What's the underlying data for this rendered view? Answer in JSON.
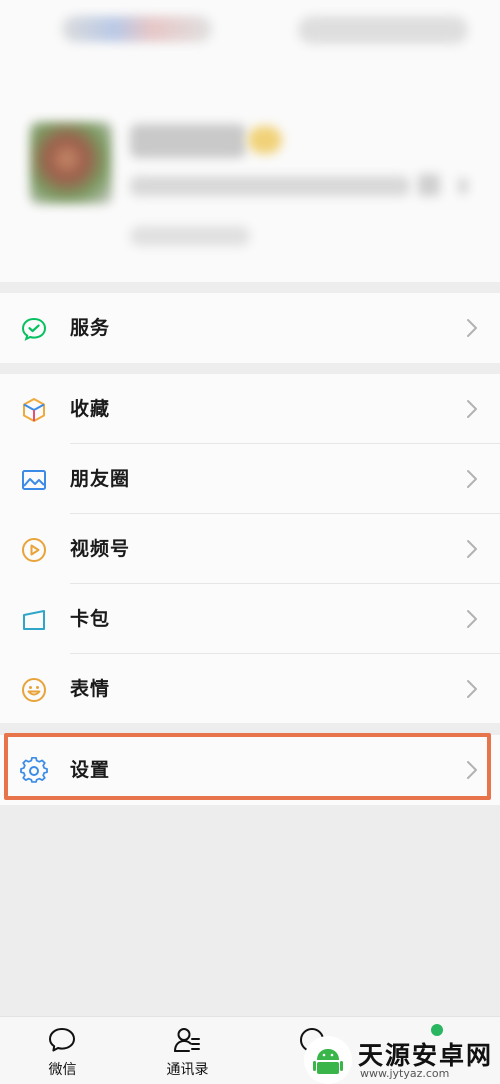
{
  "menu": {
    "service": {
      "label": "服务",
      "icon": "wechat-pay-icon"
    },
    "favorites": {
      "label": "收藏",
      "icon": "cube-icon"
    },
    "moments": {
      "label": "朋友圈",
      "icon": "photo-icon"
    },
    "channels": {
      "label": "视频号",
      "icon": "play-icon"
    },
    "cards": {
      "label": "卡包",
      "icon": "card-icon"
    },
    "stickers": {
      "label": "表情",
      "icon": "smiley-icon"
    },
    "settings": {
      "label": "设置",
      "icon": "gear-icon"
    }
  },
  "tabbar": {
    "chats": "微信",
    "contacts": "通讯录"
  },
  "watermark": {
    "title": "天源安卓网",
    "url": "www.jytyaz.com"
  },
  "colors": {
    "highlight": "#e8744b",
    "wechat_green": "#07c160",
    "notification_dot": "#2ab661"
  }
}
